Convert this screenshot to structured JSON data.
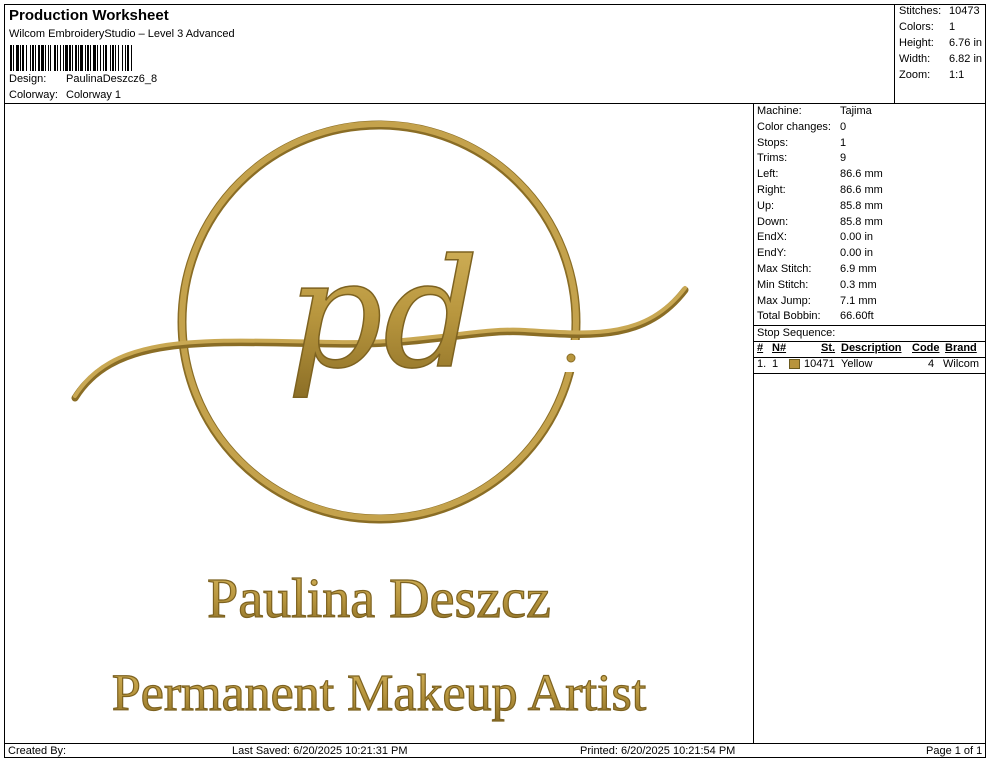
{
  "header": {
    "title": "Production Worksheet",
    "subtitle": "Wilcom EmbroideryStudio – Level 3 Advanced",
    "design_label": "Design:",
    "design_value": "PaulinaDeszcz6_8",
    "colorway_label": "Colorway:",
    "colorway_value": "Colorway 1"
  },
  "stats": {
    "stitches_label": "Stitches:",
    "stitches": "10473",
    "colors_label": "Colors:",
    "colors": "1",
    "height_label": "Height:",
    "height": "6.76 in",
    "width_label": "Width:",
    "width": "6.82 in",
    "zoom_label": "Zoom:",
    "zoom": "1:1"
  },
  "machine_info": [
    {
      "label": "Machine:",
      "value": "Tajima"
    },
    {
      "label": "Color changes:",
      "value": "0"
    },
    {
      "label": "Stops:",
      "value": "1"
    },
    {
      "label": "Trims:",
      "value": "9"
    },
    {
      "label": "Left:",
      "value": "86.6 mm"
    },
    {
      "label": "Right:",
      "value": "86.6 mm"
    },
    {
      "label": "Up:",
      "value": "85.8 mm"
    },
    {
      "label": "Down:",
      "value": "85.8 mm"
    },
    {
      "label": "EndX:",
      "value": "0.00 in"
    },
    {
      "label": "EndY:",
      "value": "0.00 in"
    },
    {
      "label": "Max Stitch:",
      "value": "6.9 mm"
    },
    {
      "label": "Min Stitch:",
      "value": "0.3 mm"
    },
    {
      "label": "Max Jump:",
      "value": "7.1 mm"
    },
    {
      "label": "Total Bobbin:",
      "value": "66.60ft"
    }
  ],
  "stop_sequence": {
    "title": "Stop Sequence:",
    "columns": [
      "#",
      "N#",
      "St.",
      "Description",
      "Code",
      "Brand"
    ],
    "rows": [
      {
        "index": "1.",
        "needle": "1",
        "swatch_color": "#b8943c",
        "stitches": "10471",
        "description": "Yellow",
        "code": "4",
        "brand": "Wilcom"
      }
    ]
  },
  "design": {
    "monogram": "pd",
    "name": "Paulina Deszcz",
    "tagline": "Permanent Makeup Artist",
    "thread_color": "#b8963e",
    "thread_shadow": "#8a6d25"
  },
  "footer": {
    "created_by": "Created By:",
    "last_saved": "Last Saved: 6/20/2025 10:21:31 PM",
    "printed": "Printed: 6/20/2025 10:21:54 PM",
    "page": "Page 1 of 1"
  }
}
